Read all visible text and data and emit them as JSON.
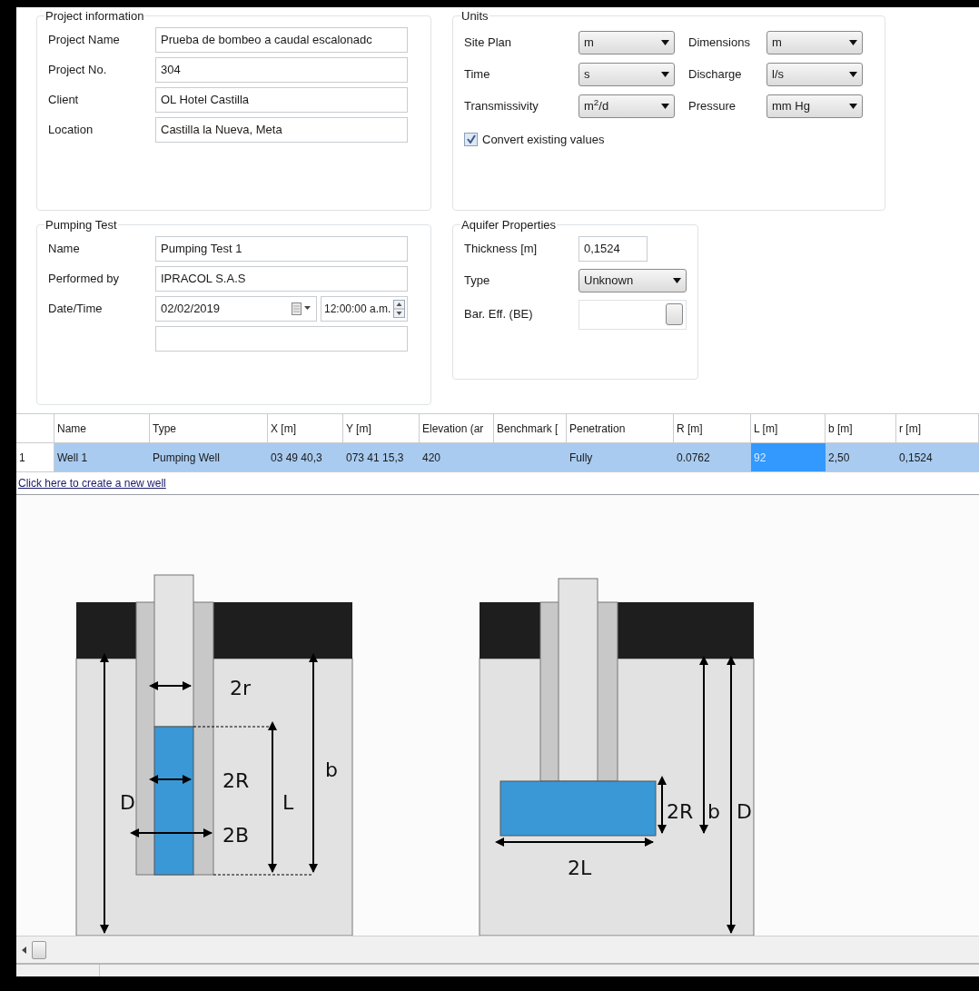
{
  "project_information": {
    "title": "Project information",
    "fields": [
      {
        "label": "Project Name",
        "value": "Prueba de bombeo a caudal escalonadc"
      },
      {
        "label": "Project No.",
        "value": "304"
      },
      {
        "label": "Client",
        "value": "OL Hotel Castilla"
      },
      {
        "label": "Location",
        "value": "Castilla la Nueva, Meta"
      }
    ]
  },
  "units": {
    "title": "Units",
    "selects": [
      {
        "label": "Site Plan",
        "value": "m"
      },
      {
        "label": "Dimensions",
        "value": "m"
      },
      {
        "label": "Time",
        "value": "s"
      },
      {
        "label": "Discharge",
        "value": "l/s"
      },
      {
        "label": "Transmissivity",
        "value": "m$^{2}$/d"
      },
      {
        "label": "Pressure",
        "value": "mm Hg"
      }
    ],
    "convert": {
      "label": "Convert existing values",
      "checked": true
    }
  },
  "pumping_test": {
    "title": "Pumping Test",
    "fields": [
      {
        "kind": "text",
        "label": "Name",
        "value": "Pumping Test 1"
      },
      {
        "kind": "text",
        "label": "Performed by",
        "value": "IPRACOL S.A.S"
      },
      {
        "kind": "datetime",
        "label": "Date/Time",
        "date": "02/02/2019",
        "time": "12:00:00 a.m."
      },
      {
        "kind": "empty"
      }
    ]
  },
  "aquifer_properties": {
    "title": "Aquifer Properties",
    "fields": [
      {
        "kind": "text",
        "label": "Thickness [m]",
        "value": "0,1524"
      },
      {
        "kind": "select",
        "label": "Type",
        "value": "Unknown"
      },
      {
        "kind": "button_field",
        "label": "Bar. Eff. (BE)"
      }
    ]
  },
  "wells_table": {
    "columns": [
      "Name",
      "Type",
      "X [m]",
      "Y [m]",
      "Elevation (ar",
      "Benchmark [",
      "Penetration",
      "R [m]",
      "L [m]",
      "b [m]",
      "r [m]"
    ],
    "rows": [
      {
        "number": "1",
        "selected": true,
        "cells": [
          {
            "text": "Well 1",
            "focused": false
          },
          {
            "text": "Pumping Well",
            "focused": false
          },
          {
            "text": "03 49 40,3",
            "focused": false
          },
          {
            "text": "073 41 15,3",
            "focused": false
          },
          {
            "text": "420",
            "focused": false
          },
          {
            "focused": false
          },
          {
            "text": "Fully",
            "focused": false
          },
          {
            "text": "0.0762",
            "focused": false
          },
          {
            "text": "92",
            "focused": true
          },
          {
            "text": "2,50",
            "focused": false
          },
          {
            "text": "0,1524",
            "focused": false
          }
        ]
      }
    ],
    "new_well_link": "Click here to create a new well"
  },
  "diagrams": [
    {
      "kind": "vertical",
      "labels": [
        "2r",
        "2R",
        "2B",
        "L",
        "b",
        "D"
      ]
    },
    {
      "kind": "horizontal",
      "labels": [
        "2R",
        "b",
        "D",
        "2L"
      ]
    }
  ]
}
